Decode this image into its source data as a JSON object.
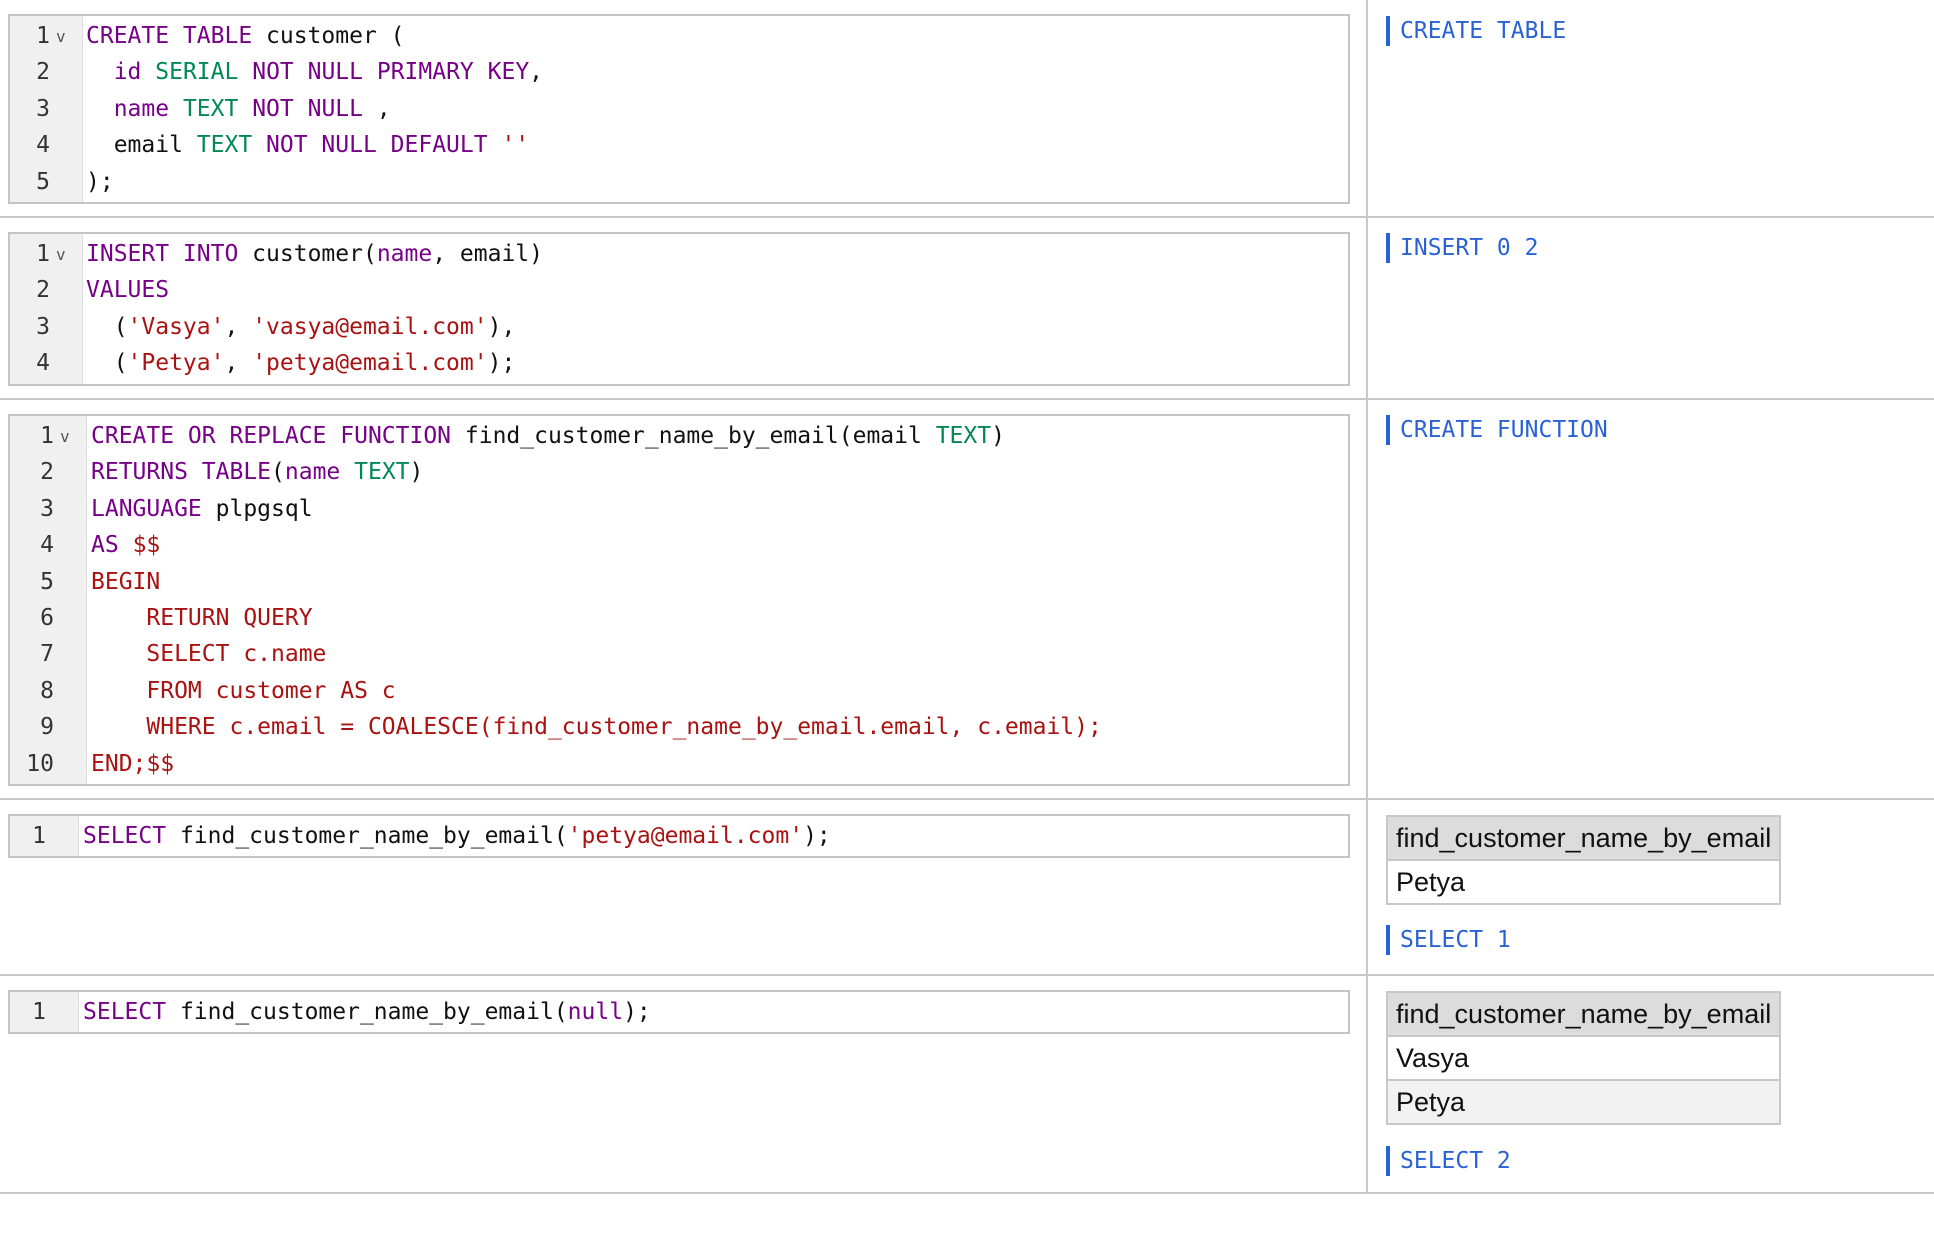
{
  "blocks": [
    {
      "lines": [
        {
          "num": "1",
          "fold": true,
          "tokens": [
            [
              "kw",
              "CREATE TABLE"
            ],
            [
              "pl",
              " customer ("
            ]
          ]
        },
        {
          "num": "2",
          "tokens": [
            [
              "pl",
              "  "
            ],
            [
              "kw",
              "id"
            ],
            [
              "pl",
              " "
            ],
            [
              "ty",
              "SERIAL"
            ],
            [
              "pl",
              " "
            ],
            [
              "kw",
              "NOT NULL PRIMARY KEY"
            ],
            [
              "pl",
              ","
            ]
          ]
        },
        {
          "num": "3",
          "tokens": [
            [
              "pl",
              "  "
            ],
            [
              "kw",
              "name"
            ],
            [
              "pl",
              " "
            ],
            [
              "ty",
              "TEXT"
            ],
            [
              "pl",
              " "
            ],
            [
              "kw",
              "NOT NULL"
            ],
            [
              "pl",
              " ,"
            ]
          ]
        },
        {
          "num": "4",
          "tokens": [
            [
              "pl",
              "  email "
            ],
            [
              "ty",
              "TEXT"
            ],
            [
              "pl",
              " "
            ],
            [
              "kw",
              "NOT NULL DEFAULT"
            ],
            [
              "pl",
              " "
            ],
            [
              "st",
              "''"
            ]
          ]
        },
        {
          "num": "5",
          "tokens": [
            [
              "pl",
              ");"
            ]
          ]
        }
      ],
      "result": {
        "status": "CREATE TABLE"
      }
    },
    {
      "lines": [
        {
          "num": "1",
          "fold": true,
          "tokens": [
            [
              "kw",
              "INSERT INTO"
            ],
            [
              "pl",
              " customer("
            ],
            [
              "kw",
              "name"
            ],
            [
              "pl",
              ", email)"
            ]
          ]
        },
        {
          "num": "2",
          "tokens": [
            [
              "kw",
              "VALUES"
            ]
          ]
        },
        {
          "num": "3",
          "tokens": [
            [
              "pl",
              "  ("
            ],
            [
              "st",
              "'Vasya'"
            ],
            [
              "pl",
              ", "
            ],
            [
              "st",
              "'vasya@email.com'"
            ],
            [
              "pl",
              "),"
            ]
          ]
        },
        {
          "num": "4",
          "tokens": [
            [
              "pl",
              "  ("
            ],
            [
              "st",
              "'Petya'"
            ],
            [
              "pl",
              ", "
            ],
            [
              "st",
              "'petya@email.com'"
            ],
            [
              "pl",
              ");"
            ]
          ]
        }
      ],
      "result": {
        "status": "INSERT 0 2"
      }
    },
    {
      "lines": [
        {
          "num": "1",
          "fold": true,
          "tokens": [
            [
              "kw",
              "CREATE OR REPLACE FUNCTION"
            ],
            [
              "pl",
              " find_customer_name_by_email(email "
            ],
            [
              "ty",
              "TEXT"
            ],
            [
              "pl",
              ")"
            ]
          ]
        },
        {
          "num": "2",
          "tokens": [
            [
              "kw",
              "RETURNS TABLE"
            ],
            [
              "pl",
              "("
            ],
            [
              "kw",
              "name"
            ],
            [
              "pl",
              " "
            ],
            [
              "ty",
              "TEXT"
            ],
            [
              "pl",
              ")"
            ]
          ]
        },
        {
          "num": "3",
          "tokens": [
            [
              "kw",
              "LANGUAGE"
            ],
            [
              "pl",
              " plpgsql"
            ]
          ]
        },
        {
          "num": "4",
          "tokens": [
            [
              "kw",
              "AS"
            ],
            [
              "pl",
              " "
            ],
            [
              "st",
              "$$"
            ]
          ]
        },
        {
          "num": "5",
          "tokens": [
            [
              "st",
              "BEGIN"
            ]
          ]
        },
        {
          "num": "6",
          "tokens": [
            [
              "st",
              "    RETURN QUERY"
            ]
          ]
        },
        {
          "num": "7",
          "tokens": [
            [
              "st",
              "    SELECT c.name"
            ]
          ]
        },
        {
          "num": "8",
          "tokens": [
            [
              "st",
              "    FROM customer AS c"
            ]
          ]
        },
        {
          "num": "9",
          "tokens": [
            [
              "st",
              "    WHERE c.email = COALESCE(find_customer_name_by_email.email, c.email);"
            ]
          ]
        },
        {
          "num": "10",
          "tokens": [
            [
              "st",
              "END;$$"
            ]
          ]
        }
      ],
      "result": {
        "status": "CREATE FUNCTION"
      }
    },
    {
      "lines": [
        {
          "num": "1",
          "tokens": [
            [
              "kw",
              "SELECT"
            ],
            [
              "pl",
              " find_customer_name_by_email("
            ],
            [
              "st",
              "'petya@email.com'"
            ],
            [
              "pl",
              ");"
            ]
          ]
        }
      ],
      "result": {
        "table": {
          "header": "find_customer_name_by_email",
          "rows": [
            "Petya"
          ]
        },
        "status": "SELECT 1"
      }
    },
    {
      "lines": [
        {
          "num": "1",
          "tokens": [
            [
              "kw",
              "SELECT"
            ],
            [
              "pl",
              " find_customer_name_by_email("
            ],
            [
              "kw",
              "null"
            ],
            [
              "pl",
              ");"
            ]
          ]
        }
      ],
      "result": {
        "table": {
          "header": "find_customer_name_by_email",
          "rows": [
            "Vasya",
            "Petya"
          ]
        },
        "status": "SELECT 2"
      }
    }
  ],
  "colors": {
    "keyword": "#770088",
    "type": "#008855",
    "string": "#aa1111",
    "status": "#2a62d6"
  }
}
